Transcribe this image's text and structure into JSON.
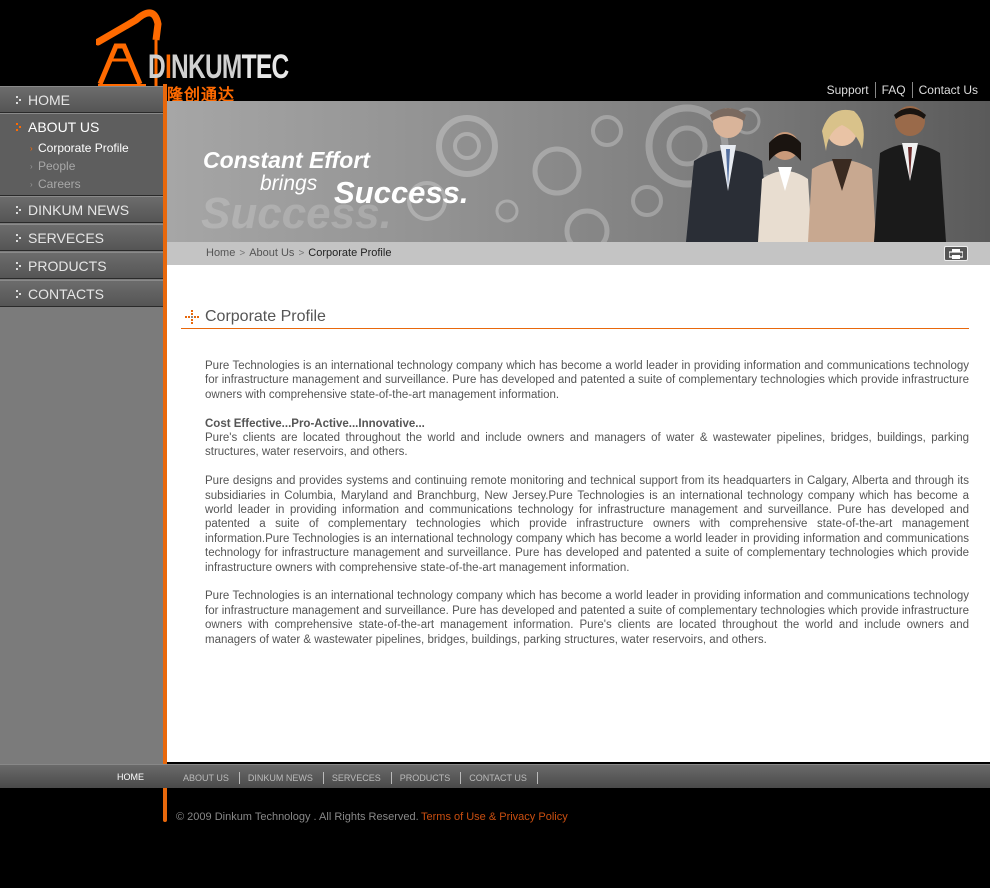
{
  "logo": {
    "word_a": "D",
    "word_b": "NKUM",
    "word_c": "TEC",
    "chinese": "隆创通达"
  },
  "colors": {
    "accent": "#e8680c",
    "background": "#000000",
    "sidebar": "#7b7b7b",
    "content_bg": "#ffffff",
    "text": "#555555",
    "link_orange": "#c94e10"
  },
  "top_links": [
    "Support",
    "FAQ",
    "Contact Us"
  ],
  "sidebar": {
    "home": "HOME",
    "about": "ABOUT US",
    "about_sub": [
      "Corporate Profile",
      "People",
      "Careers"
    ],
    "items": [
      "DINKUM NEWS",
      "SERVECES",
      "PRODUCTS",
      "CONTACTS"
    ]
  },
  "banner": {
    "line1": "Constant Effort",
    "line2": "brings",
    "line3": "Success.",
    "ghost": "Success."
  },
  "breadcrumb": {
    "home": "Home",
    "about": "About Us",
    "current": "Corporate Profile"
  },
  "icons": {
    "print": "print-icon",
    "section": "plus-bullet-icon",
    "nav": "dots-icon"
  },
  "main": {
    "title": "Corporate Profile",
    "p1": "Pure Technologies is an international technology company which has become a world leader in providing information and communications technology for infrastructure management and surveillance. Pure has developed and patented a suite of complementary technologies which provide infrastructure owners with comprehensive state-of-the-art management information.",
    "subheading": "Cost Effective...Pro-Active...Innovative...",
    "p2": "Pure's clients are located throughout the world and include owners and managers of water & wastewater pipelines, bridges, buildings, parking structures, water reservoirs, and others.",
    "p3": "Pure designs and provides systems and continuing remote monitoring and technical support from its headquarters in Calgary, Alberta and through its subsidiaries in Columbia, Maryland and Branchburg, New Jersey.Pure Technologies is an international technology company which has become a world leader in providing information and communications technology for infrastructure management and surveillance. Pure has developed and patented a suite of complementary technologies which provide infrastructure owners with comprehensive state-of-the-art management information.Pure Technologies is an international technology company which has become a world leader in providing information and communications technology for infrastructure management and surveillance. Pure has developed and patented a suite of complementary technologies which provide infrastructure owners with comprehensive state-of-the-art management information.",
    "p4": "Pure Technologies is an international technology company which has become a world leader in providing information and communications technology for infrastructure management and surveillance. Pure has developed and patented a suite of complementary technologies which provide infrastructure owners with comprehensive state-of-the-art management information. Pure's clients are located throughout the world and include owners and managers of water & wastewater pipelines, bridges, buildings, parking structures, water reservoirs, and others."
  },
  "footer": {
    "home": "HOME",
    "links": [
      "ABOUT US",
      "DINKUM NEWS",
      "SERVECES",
      "PRODUCTS",
      "CONTACT US"
    ],
    "copyright": "© 2009 Dinkum Technology . All Rights Reserved.",
    "terms": "Terms of Use & Privacy Policy"
  }
}
